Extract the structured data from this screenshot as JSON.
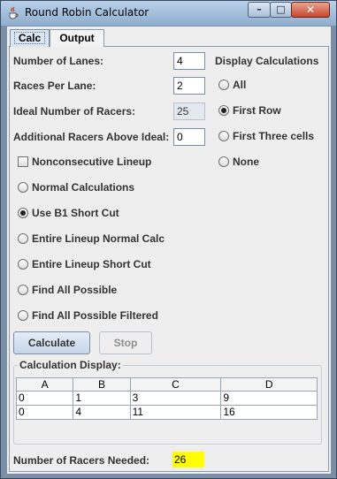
{
  "window": {
    "title": "Round Robin Calculator",
    "minimize_glyph": "–",
    "maximize_glyph": "□",
    "close_glyph": "✕"
  },
  "tabs": [
    {
      "label": "Calc"
    },
    {
      "label": "Output"
    }
  ],
  "fields": {
    "lanes": {
      "label": "Number of Lanes:",
      "value": "4"
    },
    "races_per_lane": {
      "label": "Races Per Lane:",
      "value": "2"
    },
    "ideal_racers": {
      "label": "Ideal Number of Racers:",
      "value": "25"
    },
    "additional_racers": {
      "label": "Additional Racers Above Ideal:",
      "value": "0"
    }
  },
  "display_calculations": {
    "heading": "Display Calculations",
    "options": [
      {
        "label": "All",
        "selected": false
      },
      {
        "label": "First Row",
        "selected": true
      },
      {
        "label": "First Three cells",
        "selected": false
      },
      {
        "label": "None",
        "selected": false
      }
    ]
  },
  "nonconsecutive": {
    "label": "Nonconsecutive Lineup",
    "checked": false
  },
  "methods": [
    {
      "label": "Normal Calculations",
      "selected": false
    },
    {
      "label": "Use B1 Short Cut",
      "selected": true
    },
    {
      "label": "Entire Lineup Normal Calc",
      "selected": false
    },
    {
      "label": "Entire Lineup Short Cut",
      "selected": false
    },
    {
      "label": "Find All Possible",
      "selected": false
    },
    {
      "label": "Find All Possible Filtered",
      "selected": false
    }
  ],
  "buttons": {
    "calculate": "Calculate",
    "stop": "Stop"
  },
  "calculation_display": {
    "title": "Calculation Display:",
    "columns": [
      "A",
      "B",
      "C",
      "D"
    ],
    "rows": [
      [
        "0",
        "1",
        "3",
        "9"
      ],
      [
        "0",
        "4",
        "11",
        "16"
      ]
    ]
  },
  "racers_needed": {
    "label": "Number of Racers Needed:",
    "value": "26"
  },
  "colors": {
    "result_highlight": "#ffff00",
    "title_bar": "#b9d0ea",
    "close_button": "#c9452c"
  }
}
